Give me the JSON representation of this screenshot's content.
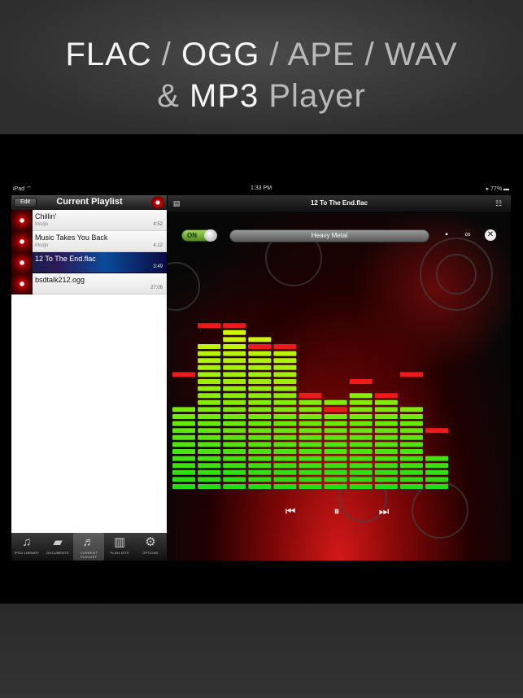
{
  "promo": {
    "line1": [
      {
        "text": "FLAC",
        "style": "hl"
      },
      {
        "text": " / ",
        "style": "dim"
      },
      {
        "text": "OGG",
        "style": "hl"
      },
      {
        "text": " / APE / WAV",
        "style": "dim"
      }
    ],
    "line2": [
      {
        "text": "& ",
        "style": "dim"
      },
      {
        "text": "MP3",
        "style": "hl"
      },
      {
        "text": " Player",
        "style": "dim"
      }
    ]
  },
  "statusbar": {
    "carrier": "iPad ⌔",
    "time": "1:33 PM",
    "battery": "▸ 77% ▬"
  },
  "playlist": {
    "edit_label": "Edit",
    "title": "Current Playlist",
    "tracks": [
      {
        "title": "Chillin'",
        "artist": "Modjo",
        "duration": "4:52",
        "active": false
      },
      {
        "title": "Music Takes You Back",
        "artist": "Modjo",
        "duration": "4:12",
        "active": false
      },
      {
        "title": "12 To The End.flac",
        "artist": "",
        "duration": "3:49",
        "active": true
      },
      {
        "title": "bsdtalk212.ogg",
        "artist": "",
        "duration": "27:06",
        "active": false
      }
    ]
  },
  "tabs": [
    {
      "label": "IPOD LIBRARY",
      "icon": "music-note-icon",
      "glyph": "♫"
    },
    {
      "label": "DOCUMENTS",
      "icon": "folder-icon",
      "glyph": "▰"
    },
    {
      "label": "CURRENT PLAYLIST",
      "icon": "playlist-icon",
      "glyph": "♬",
      "selected": true
    },
    {
      "label": "PLAYLISTS",
      "icon": "equalizer-icon",
      "glyph": "▥"
    },
    {
      "label": "OPTIONS",
      "icon": "gears-icon",
      "glyph": "⚙"
    }
  ],
  "player": {
    "now_playing": "12 To The End.flac",
    "eq_toggle_label": "ON",
    "eq_enabled": true,
    "eq_preset": "Heavy Metal"
  },
  "equalizer": {
    "levels": [
      0.42,
      0.75,
      0.82,
      0.78,
      0.73,
      0.51,
      0.45,
      0.51,
      0.47,
      0.42,
      0.18
    ],
    "peaks": [
      0.57,
      0.82,
      0.82,
      0.73,
      0.7,
      0.48,
      0.38,
      0.52,
      0.48,
      0.57,
      0.27
    ]
  },
  "colors": {
    "bar_top": "#ffff00",
    "bar_bottom": "#22dd11",
    "peak": "#ee1a1a",
    "accent_red": "#c00000"
  }
}
